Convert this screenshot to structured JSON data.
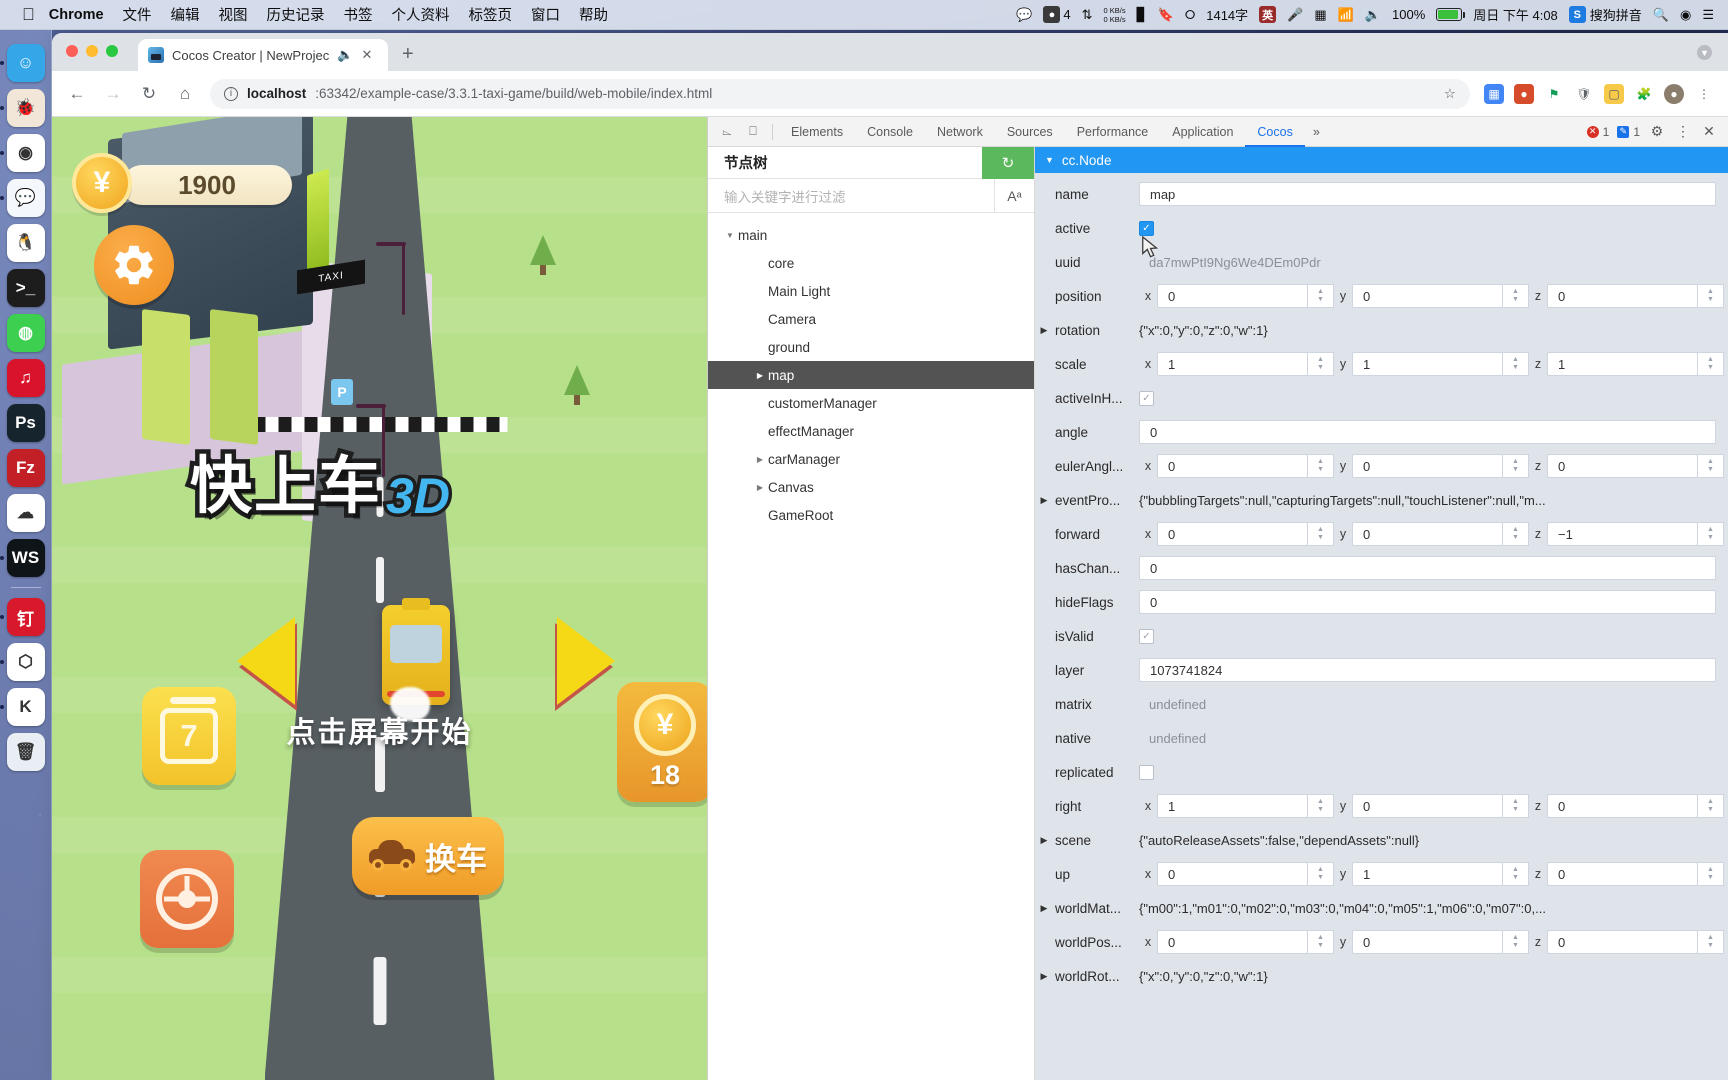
{
  "menubar": {
    "apple_icon": "apple-logo-icon",
    "items": [
      {
        "label": "Chrome",
        "bold": true
      },
      {
        "label": "文件",
        "bold": false
      },
      {
        "label": "编辑",
        "bold": false
      },
      {
        "label": "视图",
        "bold": false
      },
      {
        "label": "历史记录",
        "bold": false
      },
      {
        "label": "书签",
        "bold": false
      },
      {
        "label": "个人资料",
        "bold": false
      },
      {
        "label": "标签页",
        "bold": false
      },
      {
        "label": "窗口",
        "bold": false
      },
      {
        "label": "帮助",
        "bold": false
      }
    ],
    "status": {
      "siri_count": "4",
      "net_up": "0 KB/s",
      "net_down": "0 KB/s",
      "word_count": "1414字",
      "ime_label": "英",
      "battery_pct": "100%",
      "clock": "周日 下午 4:08",
      "ime_name": "搜狗拼音",
      "search_icon": "search-icon",
      "control_center_icon": "control-center-icon"
    }
  },
  "dock": {
    "items": [
      {
        "name": "finder",
        "glyph": "☺",
        "bg": "#35a7e8",
        "running": true
      },
      {
        "name": "ladybug-app",
        "glyph": "🐞",
        "bg": "#f2e6d8",
        "running": true
      },
      {
        "name": "google-chrome",
        "glyph": "◉",
        "bg": "#ffffff",
        "running": true
      },
      {
        "name": "messages",
        "glyph": "💬",
        "bg": "#f4f7fb",
        "running": true
      },
      {
        "name": "qq",
        "glyph": "🐧",
        "bg": "#ffffff",
        "running": false
      },
      {
        "name": "terminal",
        "glyph": ">_",
        "bg": "#1d1d1d",
        "running": false
      },
      {
        "name": "wechat",
        "glyph": "◍",
        "bg": "#3ccf50",
        "running": false
      },
      {
        "name": "netease-music",
        "glyph": "♫",
        "bg": "#d8132b",
        "running": false
      },
      {
        "name": "photoshop",
        "glyph": "Ps",
        "bg": "#16242e",
        "running": false
      },
      {
        "name": "filezilla",
        "glyph": "Fz",
        "bg": "#c22026",
        "running": false
      },
      {
        "name": "baidu-netdisk",
        "glyph": "☁",
        "bg": "#ffffff",
        "running": false
      },
      {
        "name": "webstorm",
        "glyph": "WS",
        "bg": "#0f1419",
        "running": true
      },
      {
        "name": "dingtalk",
        "glyph": "钉",
        "bg": "#d8182b",
        "running": true
      },
      {
        "name": "unity-hub",
        "glyph": "⬡",
        "bg": "#ffffff",
        "running": true
      },
      {
        "name": "kingsoft",
        "glyph": "K",
        "bg": "#ffffff",
        "running": true
      },
      {
        "name": "trash",
        "glyph": "🗑",
        "bg": "#e8eef4",
        "running": false
      }
    ]
  },
  "browser": {
    "tab": {
      "title": "Cocos Creator | NewProjec",
      "favicon": "cocos-favicon",
      "mute_icon": "speaker-icon",
      "close_icon": "close-icon"
    },
    "new_tab_label": "+",
    "nav": {
      "back_icon": "back-arrow-icon",
      "forward_icon": "forward-arrow-icon",
      "reload_icon": "reload-icon",
      "home_icon": "home-icon"
    },
    "url": {
      "host": "localhost",
      "path": ":63342/example-case/3.3.1-taxi-game/build/web-mobile/index.html",
      "info_icon": "info-circle-icon",
      "star_icon": "bookmark-star-icon"
    },
    "toolbar_icons": [
      "puzzle-extension-icon",
      "chrome-profile-icon",
      "flag-icon",
      "shield-icon",
      "notebook-icon",
      "extensions-icon",
      "avatar-icon",
      "kebab-menu-icon"
    ]
  },
  "game": {
    "coin_total": "1900",
    "coin_icon": "yen-coin-icon",
    "settings_icon": "gear-icon",
    "title_zh": "快上车",
    "title_3d": "3D",
    "tap_hint": "点击屏幕开始",
    "left_arrow_icon": "left-arrow-icon",
    "right_arrow_icon": "right-arrow-icon",
    "calendar_value": "7",
    "calendar_icon": "calendar-icon",
    "wheel_icon": "steering-wheel-icon",
    "coin_card_value": "18",
    "swap_car_label": "换车",
    "swap_car_icon": "car-icon",
    "taxi_sign": "TAXI",
    "parking_sign": "P"
  },
  "devtools": {
    "inspect_icon": "inspect-element-icon",
    "device_icon": "device-toolbar-icon",
    "tabs": [
      {
        "label": "Elements",
        "active": false
      },
      {
        "label": "Console",
        "active": false
      },
      {
        "label": "Network",
        "active": false
      },
      {
        "label": "Sources",
        "active": false
      },
      {
        "label": "Performance",
        "active": false
      },
      {
        "label": "Application",
        "active": false
      },
      {
        "label": "Cocos",
        "active": true
      }
    ],
    "more_label": "»",
    "error_count": "1",
    "warning_count": "1",
    "settings_icon": "gear-icon",
    "kebab_icon": "kebab-menu-icon",
    "close_icon": "close-icon"
  },
  "nodetree": {
    "title": "节点树",
    "refresh_icon": "refresh-icon",
    "filter_placeholder": "输入关键字进行过滤",
    "match_case_icon": "match-case-icon",
    "nodes": [
      {
        "label": "main",
        "depth": 0,
        "twisty": "open",
        "selected": false
      },
      {
        "label": "core",
        "depth": 1,
        "twisty": "none",
        "selected": false
      },
      {
        "label": "Main Light",
        "depth": 1,
        "twisty": "none",
        "selected": false
      },
      {
        "label": "Camera",
        "depth": 1,
        "twisty": "none",
        "selected": false
      },
      {
        "label": "ground",
        "depth": 1,
        "twisty": "none",
        "selected": false
      },
      {
        "label": "map",
        "depth": 1,
        "twisty": "closed",
        "selected": true
      },
      {
        "label": "customerManager",
        "depth": 1,
        "twisty": "none",
        "selected": false
      },
      {
        "label": "effectManager",
        "depth": 1,
        "twisty": "none",
        "selected": false
      },
      {
        "label": "carManager",
        "depth": 1,
        "twisty": "closed",
        "selected": false
      },
      {
        "label": "Canvas",
        "depth": 1,
        "twisty": "closed",
        "selected": false
      },
      {
        "label": "GameRoot",
        "depth": 1,
        "twisty": "none",
        "selected": false
      }
    ]
  },
  "properties": {
    "header": "cc.Node",
    "rows": [
      {
        "kind": "text",
        "label": "name",
        "value": "map"
      },
      {
        "kind": "checkbox",
        "label": "active",
        "checked": true,
        "style": "blue"
      },
      {
        "kind": "readonly",
        "label": "uuid",
        "value": "da7mwPtI9Ng6We4DEm0Pdr"
      },
      {
        "kind": "vec3",
        "label": "position",
        "x": "0",
        "y": "0",
        "z": "0"
      },
      {
        "kind": "expand",
        "label": "rotation",
        "value": "{\"x\":0,\"y\":0,\"z\":0,\"w\":1}"
      },
      {
        "kind": "vec3",
        "label": "scale",
        "x": "1",
        "y": "1",
        "z": "1"
      },
      {
        "kind": "checkbox",
        "label": "activeInH...",
        "checked": true,
        "style": "plain"
      },
      {
        "kind": "text",
        "label": "angle",
        "value": "0"
      },
      {
        "kind": "vec3",
        "label": "eulerAngl...",
        "x": "0",
        "y": "0",
        "z": "0"
      },
      {
        "kind": "expand",
        "label": "eventPro...",
        "value": "{\"bubblingTargets\":null,\"capturingTargets\":null,\"touchListener\":null,\"m..."
      },
      {
        "kind": "vec3",
        "label": "forward",
        "x": "0",
        "y": "0",
        "z": "−1"
      },
      {
        "kind": "text",
        "label": "hasChan...",
        "value": "0"
      },
      {
        "kind": "text",
        "label": "hideFlags",
        "value": "0"
      },
      {
        "kind": "checkbox",
        "label": "isValid",
        "checked": true,
        "style": "plain"
      },
      {
        "kind": "text",
        "label": "layer",
        "value": "1073741824"
      },
      {
        "kind": "readonly",
        "label": "matrix",
        "value": "undefined"
      },
      {
        "kind": "readonly",
        "label": "native",
        "value": "undefined"
      },
      {
        "kind": "checkbox",
        "label": "replicated",
        "checked": false,
        "style": "plain"
      },
      {
        "kind": "vec3",
        "label": "right",
        "x": "1",
        "y": "0",
        "z": "0"
      },
      {
        "kind": "expand",
        "label": "scene",
        "value": "{\"autoReleaseAssets\":false,\"dependAssets\":null}"
      },
      {
        "kind": "vec3",
        "label": "up",
        "x": "0",
        "y": "1",
        "z": "0"
      },
      {
        "kind": "expand",
        "label": "worldMat...",
        "value": "{\"m00\":1,\"m01\":0,\"m02\":0,\"m03\":0,\"m04\":0,\"m05\":1,\"m06\":0,\"m07\":0,..."
      },
      {
        "kind": "vec3",
        "label": "worldPos...",
        "x": "0",
        "y": "0",
        "z": "0"
      },
      {
        "kind": "expand",
        "label": "worldRot...",
        "value": "{\"x\":0,\"y\":0,\"z\":0,\"w\":1}"
      }
    ]
  },
  "colors": {
    "accent_blue": "#2196f3",
    "devtools_active": "#1a73e8",
    "refresh_green": "#5cb85c",
    "error_red": "#d93025",
    "selected_row": "#535353"
  }
}
